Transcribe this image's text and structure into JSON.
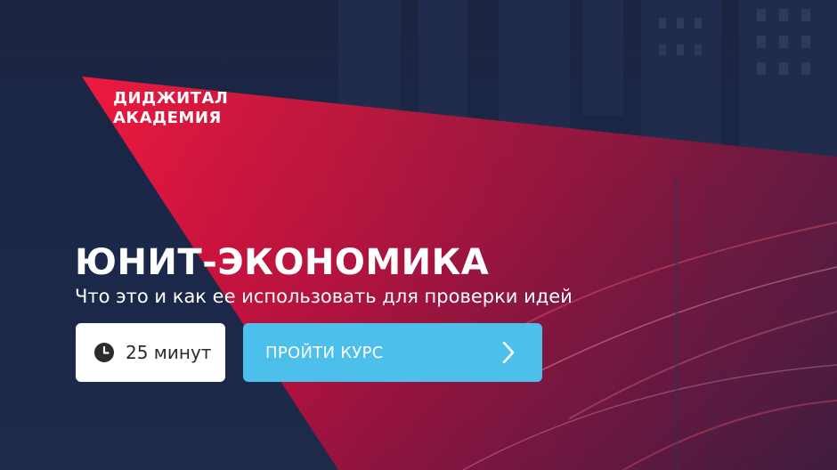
{
  "brand": {
    "line1": "ДИДЖИТАЛ",
    "line2": "АКАДЕМИЯ"
  },
  "course": {
    "title": "ЮНИТ-ЭКОНОМИКА",
    "subtitle": "Что это и как ее использовать для проверки идей",
    "duration": "25 минут",
    "cta_label": "ПРОЙТИ КУРС"
  },
  "icons": {
    "duration": "clock-icon",
    "cta": "chevron-right-icon"
  },
  "colors": {
    "background_navy": "#1c2440",
    "accent_red": "#e0103c",
    "cta_blue": "#4cc0ea",
    "text_white": "#ffffff",
    "duration_text": "#2b2b2b"
  }
}
